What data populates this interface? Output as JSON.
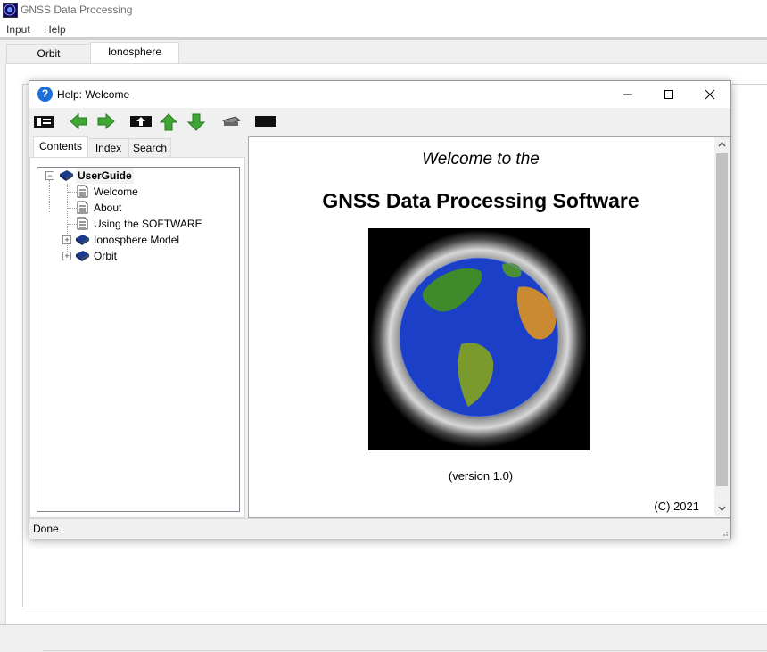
{
  "app": {
    "title": "GNSS Data Processing",
    "icon": "satellite-app-icon"
  },
  "menu": {
    "items": [
      "Input",
      "Help"
    ]
  },
  "main_tabs": [
    "Orbit",
    "Ionosphere"
  ],
  "main_active_tab": "Ionosphere",
  "help_window": {
    "title": "Help: Welcome",
    "toolbar": [
      "hide-tabs-icon",
      "back-arrow-icon",
      "forward-arrow-icon",
      "home-icon",
      "previous-topic-icon",
      "next-topic-icon",
      "print-icon",
      "options-icon"
    ],
    "nav_tabs": [
      "Contents",
      "Index",
      "Search"
    ],
    "nav_active_tab": "Contents",
    "tree": {
      "root": "UserGuide",
      "children": [
        "Welcome",
        "About",
        "Using the SOFTWARE",
        "Ionosphere Model",
        "Orbit"
      ]
    },
    "content": {
      "welcome_line": "Welcome to the",
      "product_title": "GNSS Data Processing Software",
      "image": "earth-with-satellite-debris",
      "version": "(version 1.0)",
      "copyright": "(C) 2021"
    },
    "status": "Done"
  },
  "colors": {
    "accent": "#1c6ed8",
    "arrow_green": "#3fa733",
    "book_blue": "#1a3a8c"
  }
}
